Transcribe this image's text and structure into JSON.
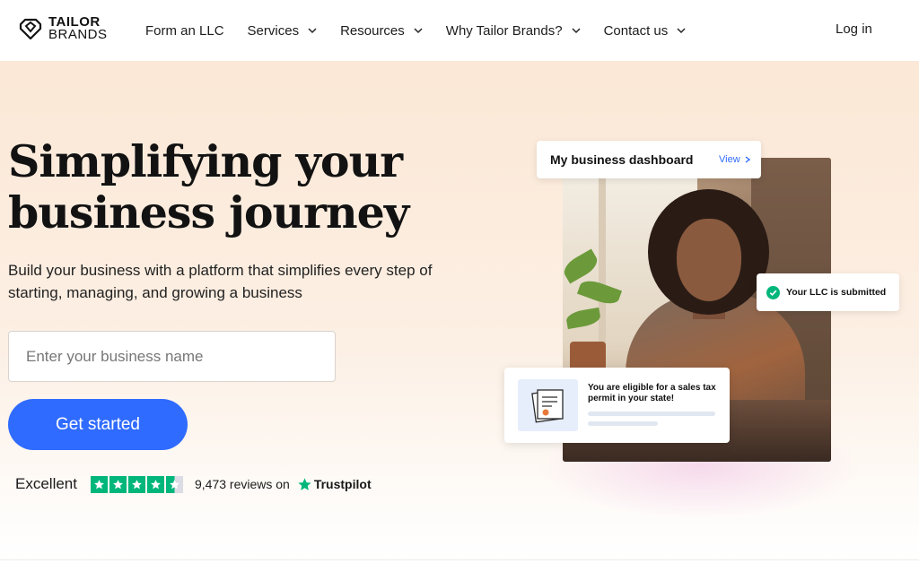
{
  "brand": {
    "name_line1": "TAILOR",
    "name_line2": "BRANDS",
    "logo_icon": "heart-shield-logo"
  },
  "nav": {
    "items": [
      {
        "label": "Form an LLC",
        "has_dropdown": false
      },
      {
        "label": "Services",
        "has_dropdown": true
      },
      {
        "label": "Resources",
        "has_dropdown": true
      },
      {
        "label": "Why Tailor Brands?",
        "has_dropdown": true
      },
      {
        "label": "Contact us",
        "has_dropdown": true
      }
    ],
    "login_label": "Log in"
  },
  "hero": {
    "headline": "Simplifying your business journey",
    "subhead": "Build your business with a platform that simplifies every step of starting, managing, and growing a business",
    "input_placeholder": "Enter your business name",
    "input_value": "",
    "cta_label": "Get started",
    "rating": {
      "label": "Excellent",
      "stars": 4.5,
      "reviews_text": "9,473 reviews on",
      "provider": "Trustpilot"
    }
  },
  "visual": {
    "dashboard_card": {
      "title": "My business dashboard",
      "link_label": "View"
    },
    "llc_card": {
      "text": "Your LLC is submitted",
      "icon": "check-circle-icon"
    },
    "tax_card": {
      "text": "You are eligible for a sales tax permit in your state!",
      "icon": "document-certificate-icon"
    }
  },
  "colors": {
    "accent": "#2f6bff",
    "trustpilot_green": "#00b67a",
    "hero_bg": "#fbe8d6"
  }
}
